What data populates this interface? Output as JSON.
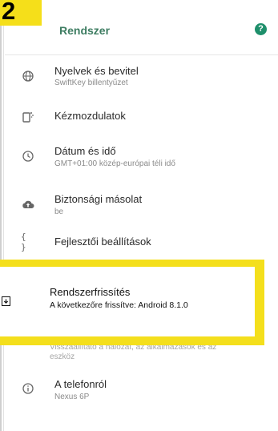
{
  "badge": "2",
  "header": {
    "title": "Rendszer",
    "help_icon": "help-icon"
  },
  "items": [
    {
      "icon": "globe-icon",
      "title": "Nyelvek és bevitel",
      "subtitle": "SwiftKey billentyűzet"
    },
    {
      "icon": "gesture-icon",
      "title": "Kézmozdulatok",
      "subtitle": ""
    },
    {
      "icon": "clock-icon",
      "title": "Dátum és idő",
      "subtitle": "GMT+01:00 közép-európai téli idő"
    },
    {
      "icon": "cloud-upload-icon",
      "title": "Biztonsági másolat",
      "subtitle": "be"
    },
    {
      "icon": "code-braces-icon",
      "title": "Fejlesztői beállítások",
      "subtitle": ""
    }
  ],
  "highlight": {
    "icon": "system-update-icon",
    "title": "Rendszerfrissítés",
    "subtitle": "A következőre frissítve: Android 8.1.0"
  },
  "reset": {
    "subtitle_line1": "Visszaállítató a hálózat, az alkalmazások és az",
    "subtitle_line2": "eszköz"
  },
  "about": {
    "icon": "info-icon",
    "title": "A telefonról",
    "subtitle": "Nexus 6P"
  }
}
